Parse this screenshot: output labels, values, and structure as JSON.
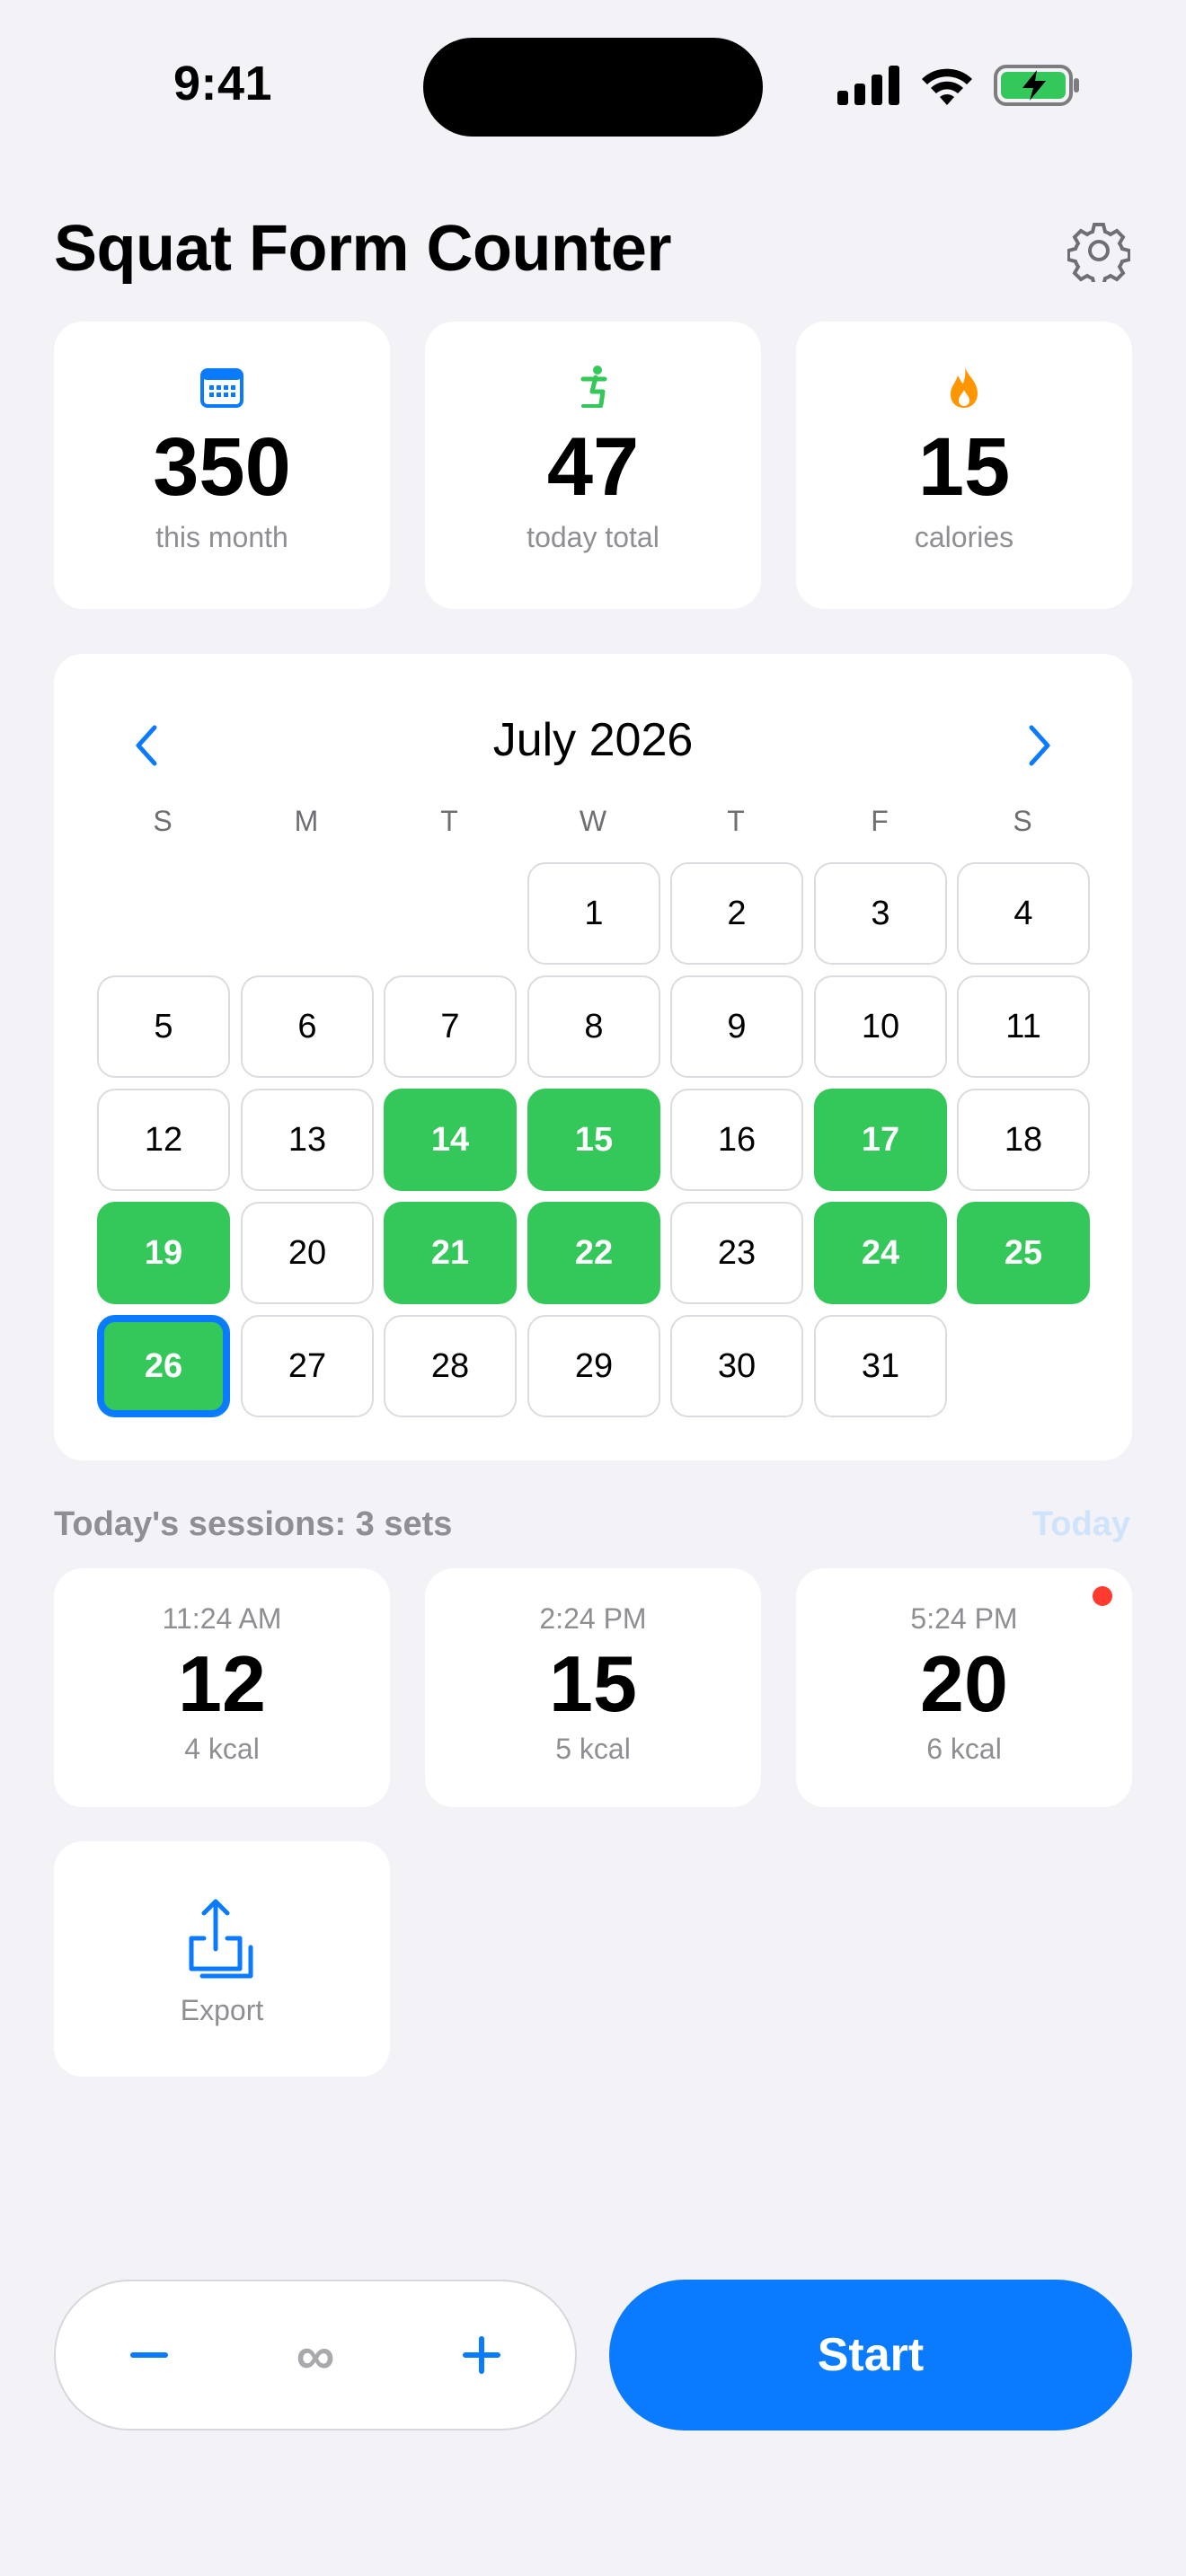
{
  "status_bar": {
    "time": "9:41"
  },
  "header": {
    "title": "Squat Form Counter"
  },
  "stats": [
    {
      "icon": "calendar-icon",
      "value": "350",
      "label": "this month",
      "color": "#0a7aff"
    },
    {
      "icon": "squat-figure-icon",
      "value": "47",
      "label": "today total",
      "color": "#34c759"
    },
    {
      "icon": "flame-icon",
      "value": "15",
      "label": "calories",
      "color": "#ff9500"
    }
  ],
  "calendar": {
    "month_label": "July 2026",
    "weekdays": [
      "S",
      "M",
      "T",
      "W",
      "T",
      "F",
      "S"
    ],
    "first_weekday_index": 3,
    "days_in_month": 31,
    "completed_days": [
      14,
      15,
      17,
      19,
      21,
      22,
      24,
      25,
      26
    ],
    "today": 26
  },
  "sessions": {
    "label": "Today's sessions: 3 sets",
    "today_link": "Today",
    "items": [
      {
        "time": "11:24 AM",
        "count": "12",
        "kcal": "4 kcal",
        "unread": false
      },
      {
        "time": "2:24 PM",
        "count": "15",
        "kcal": "5 kcal",
        "unread": false
      },
      {
        "time": "5:24 PM",
        "count": "20",
        "kcal": "6 kcal",
        "unread": true
      }
    ]
  },
  "export": {
    "label": "Export"
  },
  "controls": {
    "target_value": "∞",
    "start_label": "Start"
  },
  "colors": {
    "accent": "#0a7aff",
    "success": "#34c759",
    "alert": "#ff3b30",
    "background": "#f2f2f7"
  }
}
